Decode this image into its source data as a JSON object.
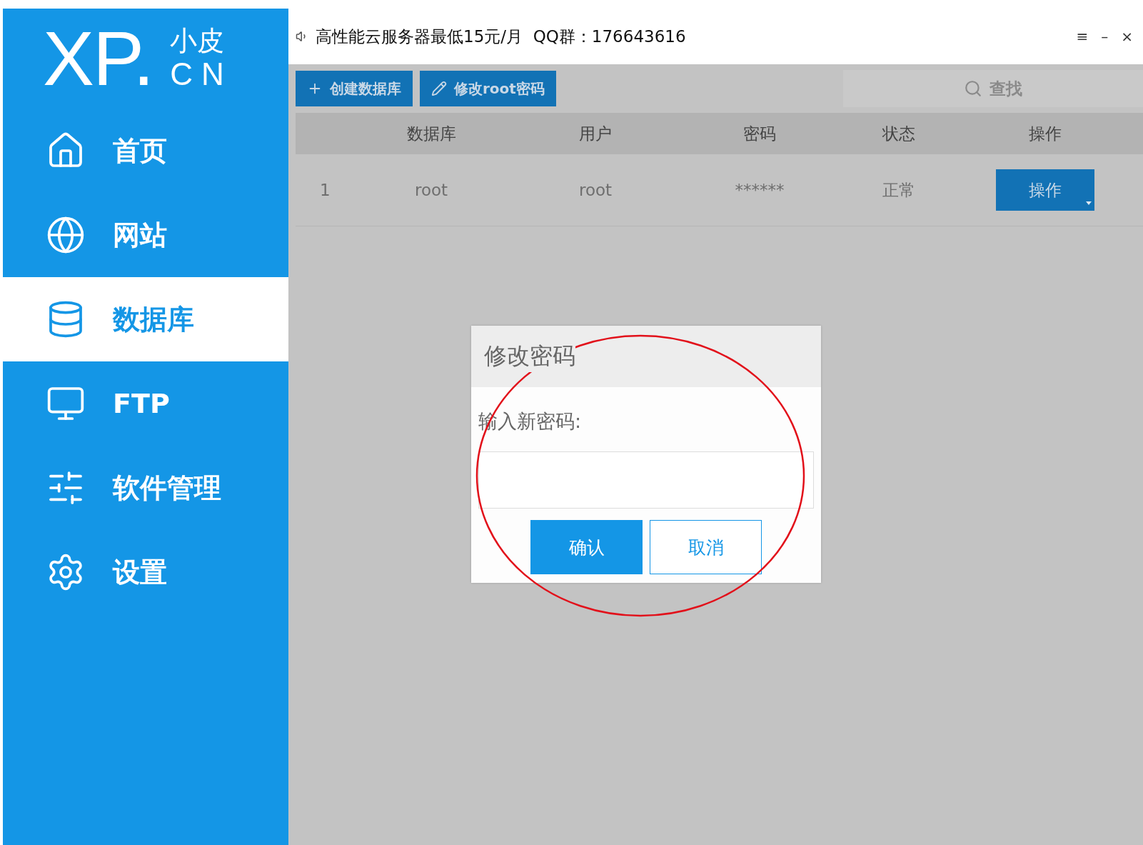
{
  "logo": {
    "mark": "XP.",
    "top": "小皮",
    "bottom": "CN"
  },
  "sidebar": {
    "items": [
      {
        "label": "首页",
        "selected": false
      },
      {
        "label": "网站",
        "selected": false
      },
      {
        "label": "数据库",
        "selected": true
      },
      {
        "label": "FTP",
        "selected": false
      },
      {
        "label": "软件管理",
        "selected": false
      },
      {
        "label": "设置",
        "selected": false
      }
    ]
  },
  "title_bar": {
    "text": "高性能云服务器最低15元/月  QQ群：176643616",
    "controls": [
      "≡",
      "–",
      "×"
    ]
  },
  "toolbar": {
    "buttons": [
      {
        "label": "创建数据库"
      },
      {
        "label": "修改root密码"
      }
    ],
    "search": {
      "placeholder": "查找"
    }
  },
  "table": {
    "columns": [
      "数据库",
      "用户",
      "密码",
      "状态",
      "操作"
    ],
    "rows": [
      {
        "index": "1",
        "database": "root",
        "user": "root",
        "password": "******",
        "status": "正常",
        "action": "操作"
      }
    ]
  },
  "dialog": {
    "title": "修改密码",
    "label": "输入新密码:",
    "buttons": [
      {
        "label": "确认",
        "kind": "primary"
      },
      {
        "label": "取消",
        "kind": "secondary"
      }
    ]
  }
}
